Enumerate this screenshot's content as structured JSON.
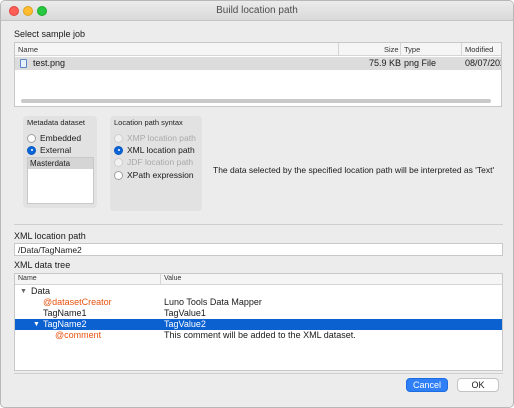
{
  "window": {
    "title": "Build location path"
  },
  "sample_job": {
    "label": "Select sample job",
    "columns": [
      "Name",
      "Size",
      "Type",
      "Modified"
    ],
    "rows": [
      {
        "name": "test.png",
        "size": "75.9 KB",
        "type": "png File",
        "modified": "08/07/202"
      }
    ]
  },
  "metadata": {
    "title": "Metadata dataset",
    "options": [
      "Embedded",
      "External"
    ],
    "selected": "External",
    "datasets": [
      "Masterdata"
    ]
  },
  "syntax": {
    "title": "Location path syntax",
    "options": [
      {
        "label": "XMP location path",
        "enabled": false,
        "selected": false
      },
      {
        "label": "XML location path",
        "enabled": true,
        "selected": true
      },
      {
        "label": "JDF location path",
        "enabled": false,
        "selected": false
      },
      {
        "label": "XPath expression",
        "enabled": true,
        "selected": false
      }
    ]
  },
  "info_text": "The data selected by the specified location path will be interpreted as 'Text'",
  "xml_path": {
    "label": "XML location path",
    "value": "/Data/TagName2"
  },
  "tree": {
    "label": "XML data tree",
    "columns": [
      "Name",
      "Value"
    ],
    "rows": [
      {
        "name": "Data",
        "value": ""
      },
      {
        "name": "@datasetCreator",
        "value": "Luno Tools Data Mapper"
      },
      {
        "name": "TagName1",
        "value": "TagValue1"
      },
      {
        "name": "TagName2",
        "value": "TagValue2"
      },
      {
        "name": "@comment",
        "value": "This comment will be added to the XML dataset."
      }
    ]
  },
  "buttons": {
    "cancel": "Cancel",
    "ok": "OK"
  },
  "colors": {
    "accent": "#0b61d0",
    "attribute": "#e8520f",
    "selection": "#dcdcdc"
  }
}
